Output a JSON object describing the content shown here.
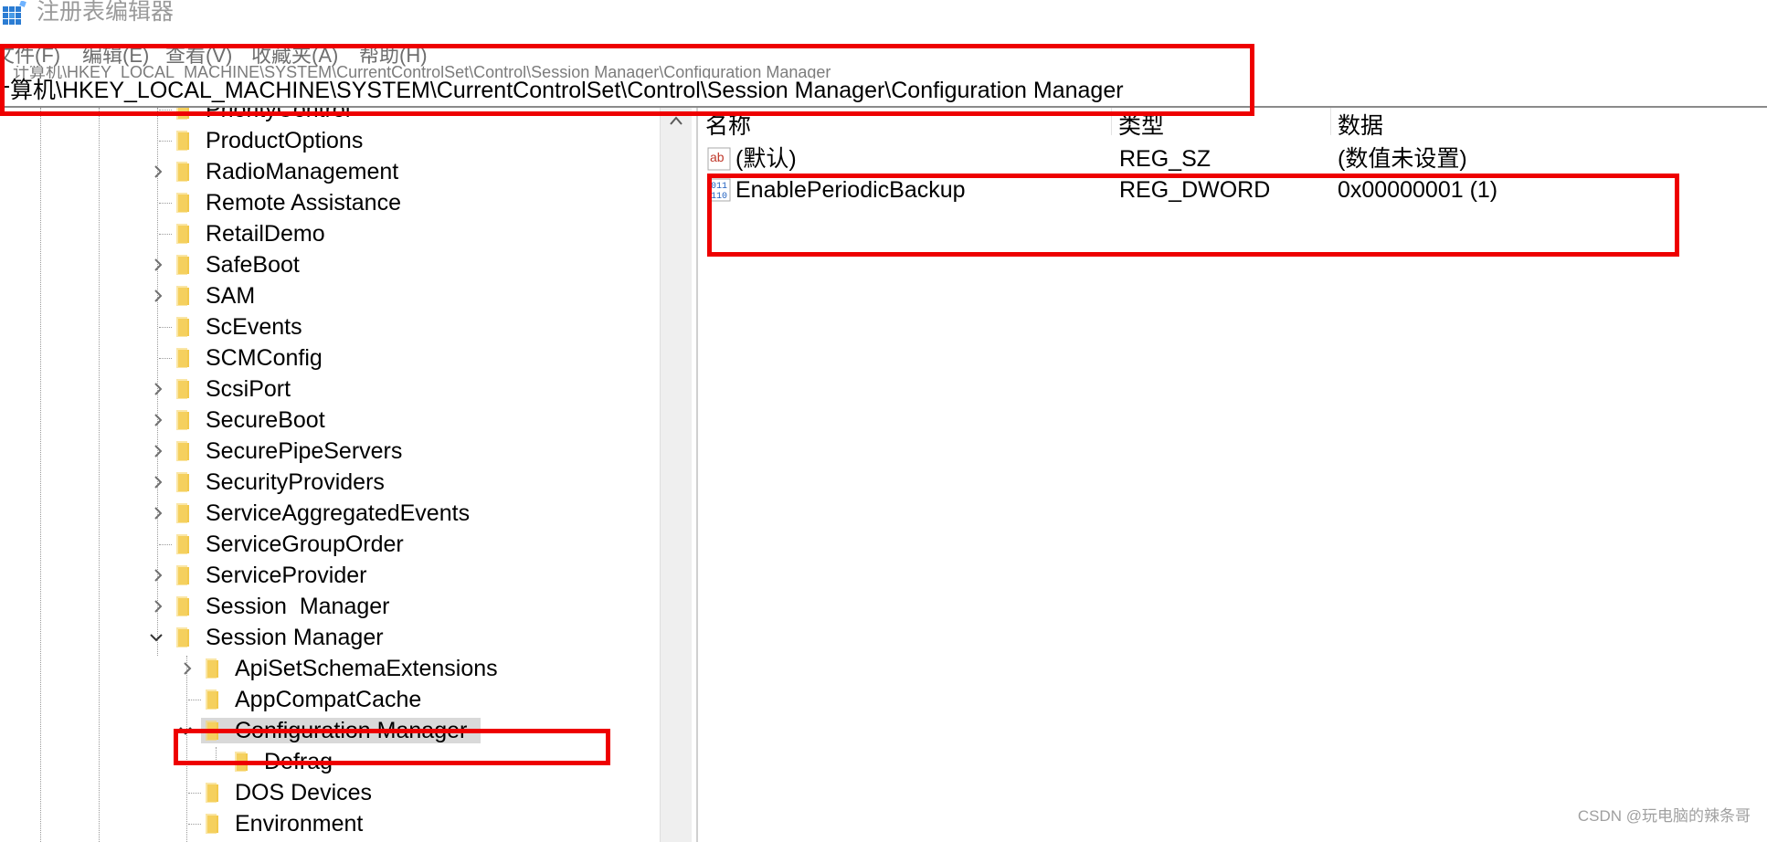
{
  "window": {
    "title": "注册表编辑器"
  },
  "menu": [
    "文件(F)",
    "编辑(E)",
    "查看(V)",
    "收藏夹(A)",
    "帮助(H)"
  ],
  "address": {
    "path": "计算机\\HKEY_LOCAL_MACHINE\\SYSTEM\\CurrentControlSet\\Control\\Session Manager\\Configuration Manager",
    "ghost_path": "计算机\\HKEY_LOCAL_MACHINE\\SYSTEM\\CurrentControlSet\\Control\\Session Manager\\Configuration Manager"
  },
  "tree": {
    "items": [
      {
        "label": "PriorityControl"
      },
      {
        "label": "ProductOptions"
      },
      {
        "label": "RadioManagement"
      },
      {
        "label": "Remote Assistance"
      },
      {
        "label": "RetailDemo"
      },
      {
        "label": "SafeBoot"
      },
      {
        "label": "SAM"
      },
      {
        "label": "ScEvents"
      },
      {
        "label": "SCMConfig"
      },
      {
        "label": "ScsiPort"
      },
      {
        "label": "SecureBoot"
      },
      {
        "label": "SecurePipeServers"
      },
      {
        "label": "SecurityProviders"
      },
      {
        "label": "ServiceAggregatedEvents"
      },
      {
        "label": "ServiceGroupOrder"
      },
      {
        "label": "ServiceProvider"
      },
      {
        "label": "Session  Manager"
      },
      {
        "label": "Session Manager"
      },
      {
        "label": "ApiSetSchemaExtensions"
      },
      {
        "label": "AppCompatCache"
      },
      {
        "label": "Configuration Manager"
      },
      {
        "label": "Defrag"
      },
      {
        "label": "DOS Devices"
      },
      {
        "label": "Environment"
      }
    ]
  },
  "values": {
    "headers": {
      "name": "名称",
      "type": "类型",
      "data": "数据"
    },
    "rows": [
      {
        "icon": "string-value-icon",
        "name": "(默认)",
        "type": "REG_SZ",
        "data": "(数值未设置)"
      },
      {
        "icon": "dword-value-icon",
        "name": "EnablePeriodicBackup",
        "type": "REG_DWORD",
        "data": "0x00000001 (1)"
      }
    ]
  },
  "watermark": "CSDN @玩电脑的辣条哥",
  "colors": {
    "annotation_red": "#ee0000",
    "folder_yellow": "#f2c94c",
    "selection_gray": "#d9d9d9"
  }
}
